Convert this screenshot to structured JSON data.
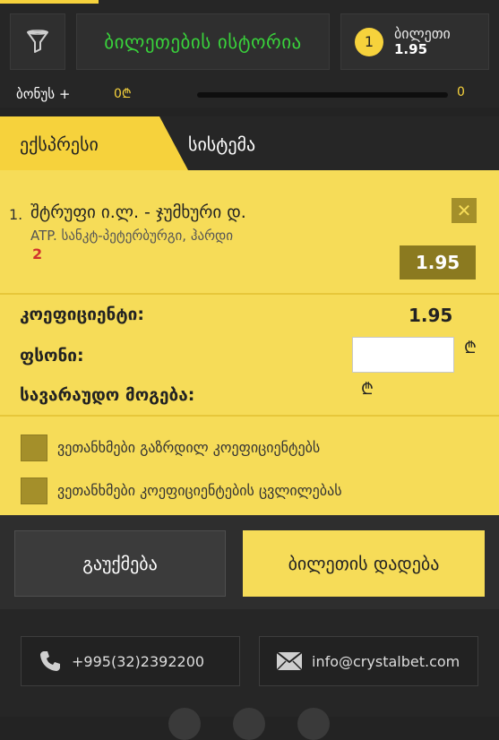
{
  "header": {
    "history_button": "ბილეთების ისტორია",
    "ticket_count": "1",
    "ticket_label": "ბილეთი",
    "ticket_odds": "1.95"
  },
  "bonus": {
    "label": "ბონუს +",
    "value": "0₾",
    "max": "0",
    "progress": 0
  },
  "tabs": [
    {
      "label": "ექსპრესი",
      "active": true
    },
    {
      "label": "სისტემა",
      "active": false
    }
  ],
  "bet": {
    "number": "1.",
    "event": "შტრუფი ი.ლ. - ჯუმხური დ.",
    "tournament": "ATP. სანკტ-პეტერბურგი, ჰარდი",
    "selection": "2",
    "odds": "1.95",
    "remove_glyph": "✕"
  },
  "summary": {
    "coef_label": "კოეფიციენტი:",
    "coef_value": "1.95",
    "stake_label": "ფსონი:",
    "stake_value": "",
    "win_label": "სავარაუდო მოგება:",
    "currency": "₾"
  },
  "options": [
    {
      "label": "ვეთანხმები გაზრდილ კოეფიციენტებს",
      "checked": false
    },
    {
      "label": "ვეთანხმები კოეფიციენტების ცვლილებას",
      "checked": false
    }
  ],
  "actions": {
    "clear_label": "გაუქმება",
    "place_label": "ბილეთის დადება"
  },
  "footer": {
    "phone": "+995(32)2392200",
    "email": "info@crystalbet.com"
  },
  "colors": {
    "accent": "#f6d23c",
    "panel": "#f6dc58",
    "history_text": "#39d23b",
    "selection_red": "#d0312d"
  },
  "icons": [
    "filter-icon",
    "close-icon",
    "phone-icon",
    "mail-icon",
    "lari-icon"
  ]
}
